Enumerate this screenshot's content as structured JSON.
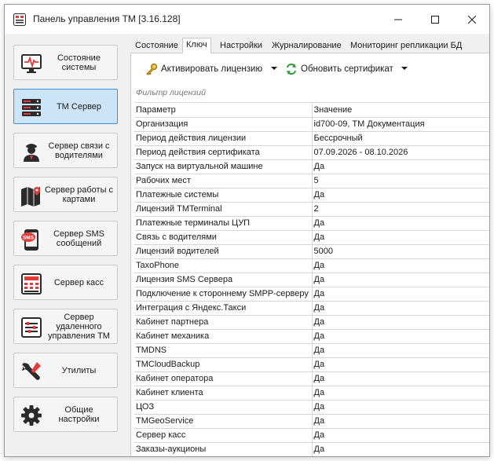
{
  "window": {
    "title": "Панель управления ТМ [3.16.128]"
  },
  "nav": {
    "items": [
      {
        "id": "state",
        "label": "Состояние\nсистемы",
        "icon": "monitor-pulse-icon",
        "active": false
      },
      {
        "id": "tm-server",
        "label": "ТМ Сервер",
        "icon": "server-icon",
        "active": true
      },
      {
        "id": "driver-server",
        "label": "Сервер связи с\nводителями",
        "icon": "driver-icon",
        "active": false
      },
      {
        "id": "map-server",
        "label": "Сервер работы с\nкартами",
        "icon": "map-icon",
        "active": false
      },
      {
        "id": "sms-server",
        "label": "Сервер SMS\nсообщений",
        "icon": "sms-icon",
        "active": false
      },
      {
        "id": "cash-server",
        "label": "Сервер касс",
        "icon": "cash-register-icon",
        "active": false
      },
      {
        "id": "remote-server",
        "label": "Сервер\nудаленного\nуправления ТМ",
        "icon": "remote-control-icon",
        "active": false
      },
      {
        "id": "utils",
        "label": "Утилиты",
        "icon": "utilities-icon",
        "active": false
      },
      {
        "id": "settings",
        "label": "Общие\nнастройки",
        "icon": "gear-icon",
        "active": false
      }
    ]
  },
  "tabs": [
    {
      "label": "Состояние",
      "active": false
    },
    {
      "label": "Ключ",
      "active": true
    },
    {
      "label": "Настройки",
      "active": false
    },
    {
      "label": "Журналирование",
      "active": false
    },
    {
      "label": "Мониторинг репликации БД",
      "active": false
    }
  ],
  "toolbar": {
    "activate_label": "Активировать лицензию",
    "update_label": "Обновить сертификат"
  },
  "filter": {
    "placeholder": "Фильтр лицензий"
  },
  "table": {
    "columns": [
      "Параметр",
      "Значение"
    ],
    "rows": [
      [
        "Организация",
        "id700-09, ТМ Документация"
      ],
      [
        "Период действия лицензии",
        "Бессрочный"
      ],
      [
        "Период действия сертификата",
        "07.09.2026 - 08.10.2026"
      ],
      [
        "Запуск на виртуальной машине",
        "Да"
      ],
      [
        "Рабочих мест",
        "5"
      ],
      [
        "Платежные системы",
        "Да"
      ],
      [
        "Лицензий TMTerminal",
        "2"
      ],
      [
        "Платежные терминалы ЦУП",
        "Да"
      ],
      [
        "Связь с водителями",
        "Да"
      ],
      [
        "Лицензий водителей",
        "5000"
      ],
      [
        "TaxoPhone",
        "Да"
      ],
      [
        "Лицензия SMS Сервера",
        "Да"
      ],
      [
        "Подключение к стороннему SMPP-серверу",
        "Да"
      ],
      [
        "Интеграция с Яндекс.Такси",
        "Да"
      ],
      [
        "Кабинет партнера",
        "Да"
      ],
      [
        "Кабинет механика",
        "Да"
      ],
      [
        "TMDNS",
        "Да"
      ],
      [
        "TMCloudBackup",
        "Да"
      ],
      [
        "Кабинет оператора",
        "Да"
      ],
      [
        "Кабинет клиента",
        "Да"
      ],
      [
        "ЦОЗ",
        "Да"
      ],
      [
        "TMGeoService",
        "Да"
      ],
      [
        "Сервер касс",
        "Да"
      ],
      [
        "Заказы-аукционы",
        "Да"
      ]
    ]
  },
  "colors": {
    "accent": "#cce4f7",
    "accent_border": "#3c8fd6",
    "icon_dark": "#2b2b2b",
    "icon_red": "#e23b3b"
  }
}
